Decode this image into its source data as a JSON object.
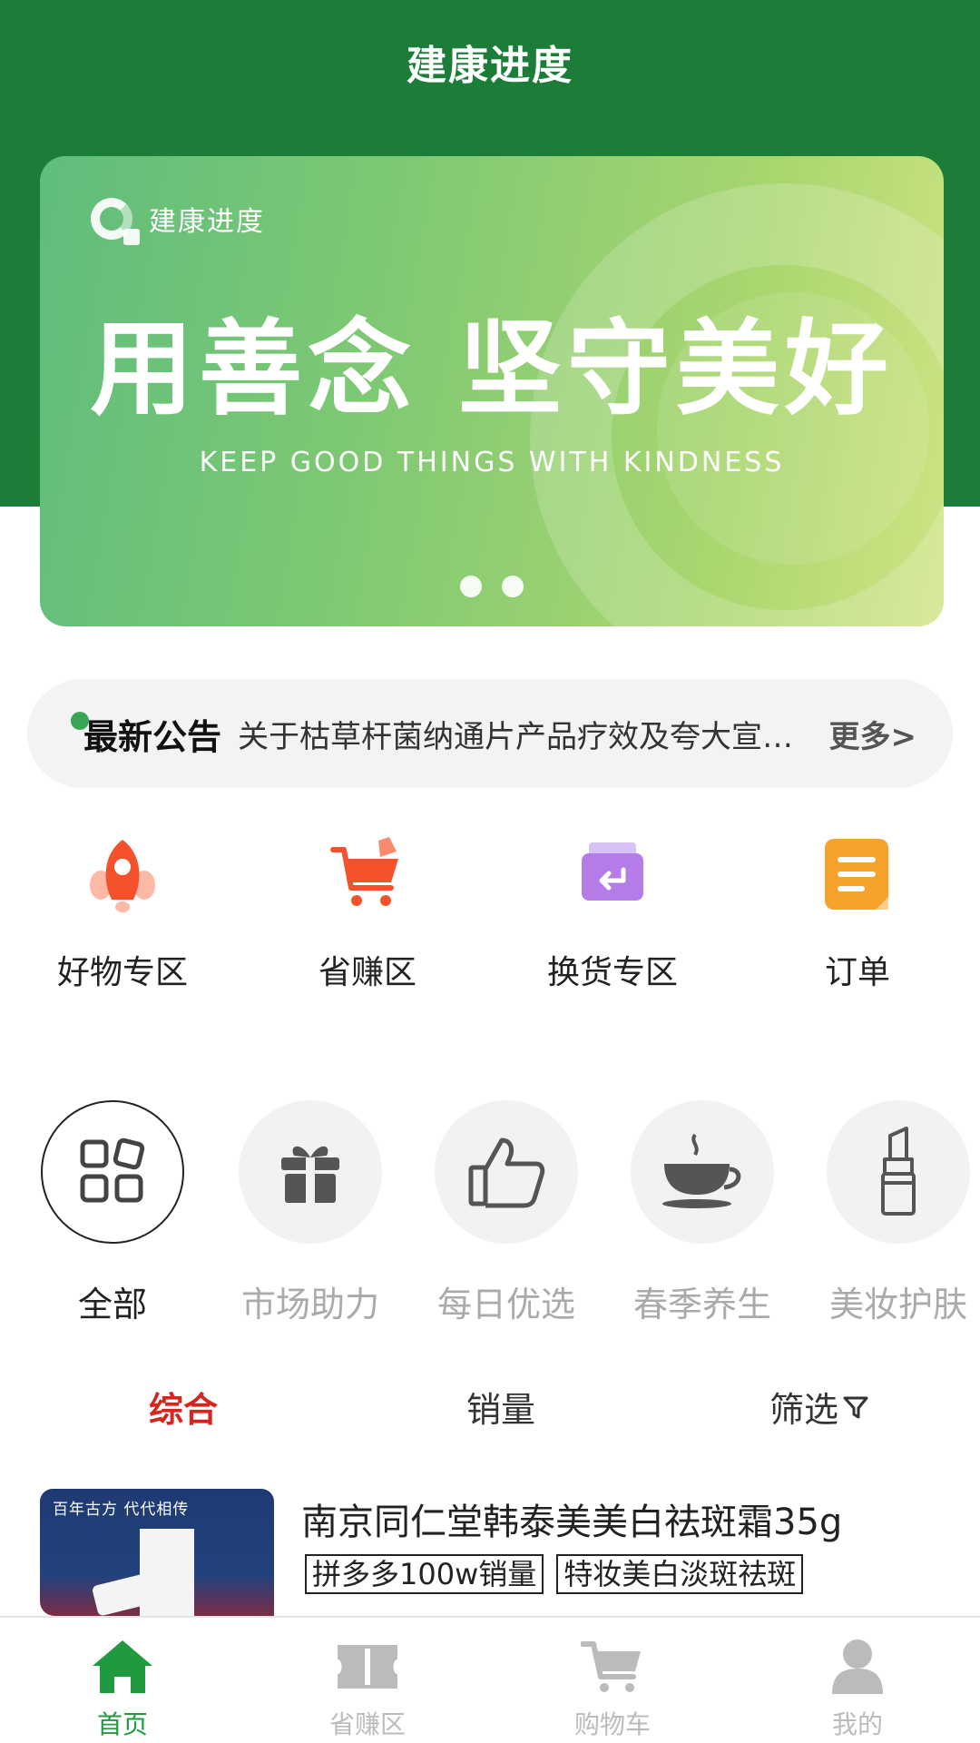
{
  "header": {
    "title": "建康进度"
  },
  "banner": {
    "logo_text": "建康进度",
    "headline": "用善念 坚守美好",
    "subline": "KEEP GOOD THINGS WITH KINDNESS",
    "slide_count": 2
  },
  "notice": {
    "title": "最新公告",
    "text": "关于枯草杆菌纳通片产品疗效及夸大宣传的公告",
    "more": "更多>"
  },
  "quick_menu": [
    {
      "label": "好物专区",
      "icon": "rocket-icon",
      "color": "#f4522d"
    },
    {
      "label": "省赚区",
      "icon": "shopping-cart-icon",
      "color": "#f4522d"
    },
    {
      "label": "换货专区",
      "icon": "exchange-box-icon",
      "color": "#b57ce8"
    },
    {
      "label": "订单",
      "icon": "document-list-icon",
      "color": "#f7a22a"
    }
  ],
  "categories": [
    {
      "label": "全部",
      "icon": "grid-icon",
      "active": true
    },
    {
      "label": "市场助力",
      "icon": "gift-icon",
      "active": false
    },
    {
      "label": "每日优选",
      "icon": "thumbs-up-icon",
      "active": false
    },
    {
      "label": "春季养生",
      "icon": "coffee-cup-icon",
      "active": false
    },
    {
      "label": "美妆护肤",
      "icon": "lipstick-icon",
      "active": false
    }
  ],
  "sort": {
    "comprehensive": "综合",
    "sales": "销量",
    "filter": "筛选"
  },
  "product": {
    "image_text": "百年古方 代代相传",
    "name": "南京同仁堂韩泰美美白祛斑霜35g",
    "tags": [
      "拼多多100w销量",
      "特妆美白淡斑祛斑"
    ]
  },
  "tabbar": [
    {
      "label": "首页",
      "icon": "home-icon",
      "active": true
    },
    {
      "label": "省赚区",
      "icon": "ticket-icon",
      "active": false
    },
    {
      "label": "购物车",
      "icon": "cart-icon",
      "active": false
    },
    {
      "label": "我的",
      "icon": "user-icon",
      "active": false
    }
  ],
  "colors": {
    "brand_green": "#1b7d37",
    "accent_red": "#d6241f",
    "tab_active": "#1f9a3f"
  }
}
